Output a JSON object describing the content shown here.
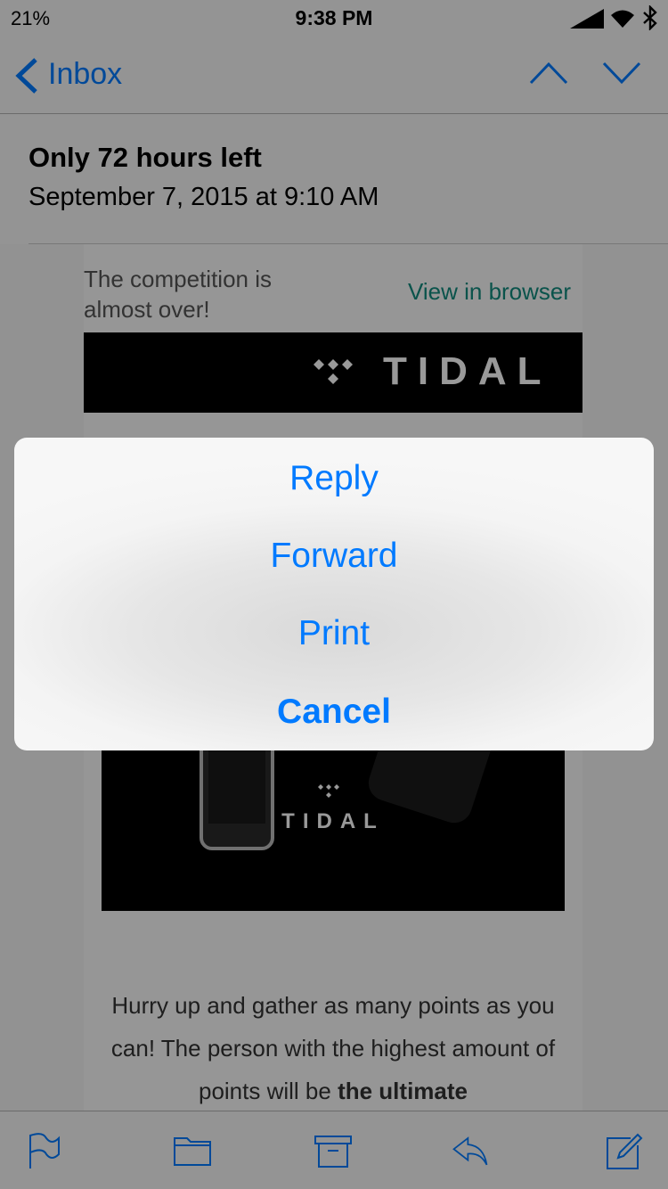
{
  "status_bar": {
    "battery": "21%",
    "time": "9:38 PM"
  },
  "nav": {
    "back_label": "Inbox"
  },
  "email": {
    "subject": "Only 72 hours left",
    "date": "September 7, 2015 at 9:10 AM",
    "preheader": "The competition is almost over!",
    "view_in_browser": "View in browser",
    "banner_brand": "TIDAL",
    "promo_brand": "TIDAL",
    "body_text": "Hurry up and gather as many points as you can! The person with the highest amount of points will be",
    "body_text_bold": "the ultimate"
  },
  "action_sheet": {
    "items": [
      "Reply",
      "Forward",
      "Print"
    ],
    "cancel": "Cancel"
  },
  "toolbar": {
    "icons": [
      "flag-icon",
      "folder-icon",
      "archive-icon",
      "reply-icon",
      "compose-icon"
    ]
  },
  "colors": {
    "accent": "#007aff",
    "link": "#118a7e"
  }
}
